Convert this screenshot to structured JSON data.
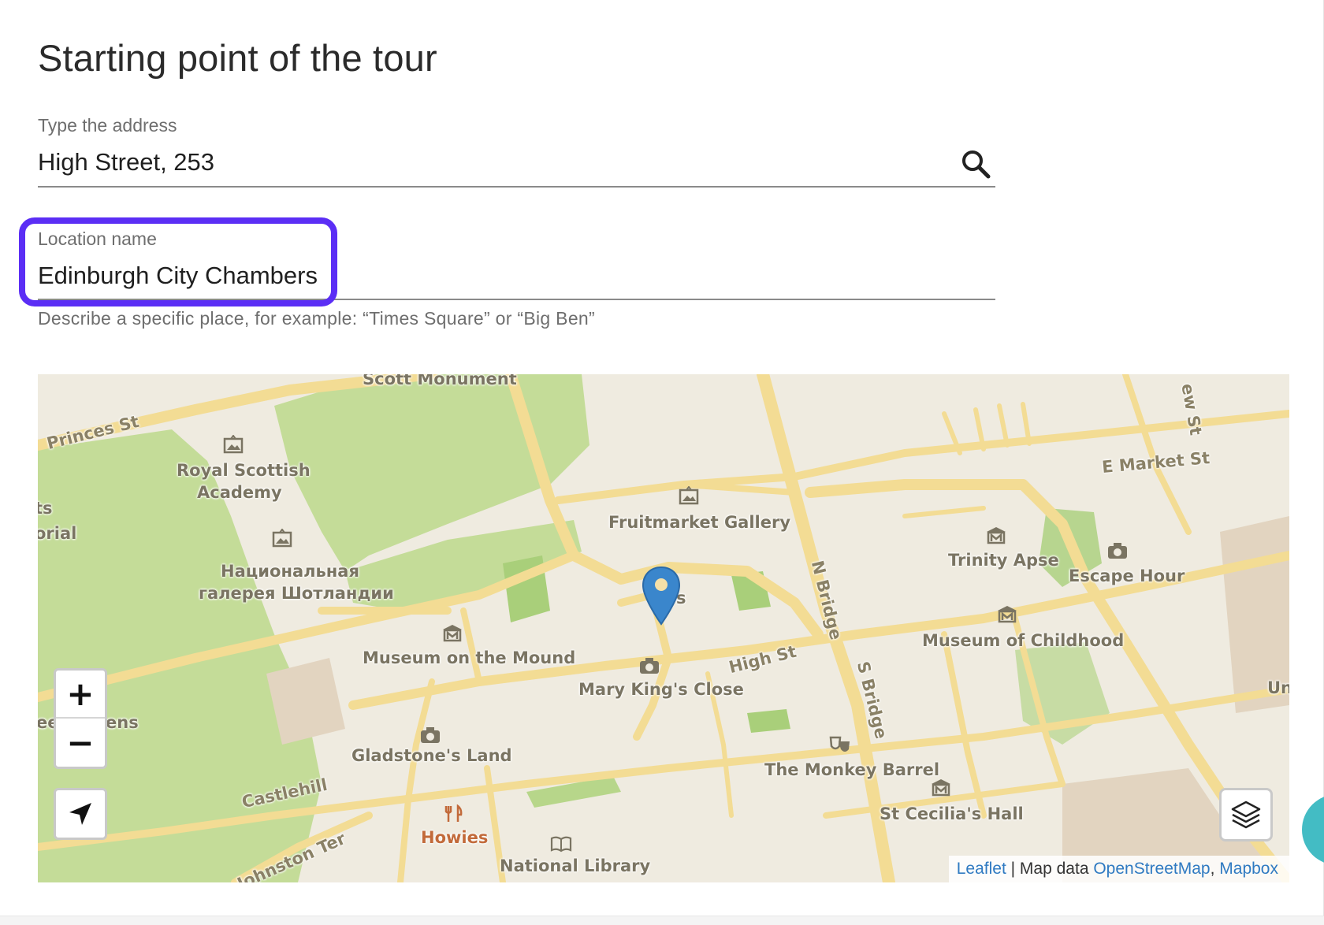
{
  "page": {
    "title": "Starting point of the tour"
  },
  "address": {
    "label": "Type the address",
    "value": "High Street, 253",
    "search_icon": "search-icon"
  },
  "location": {
    "label": "Location name",
    "value": "Edinburgh City Chambers",
    "helper": "Describe a specific place, for example: “Times Square” or “Big Ben”"
  },
  "map": {
    "labels": {
      "scott_monument": "Scott Monument",
      "princes_st": "Princes St",
      "royal_scottish": "Royal Scottish",
      "academy": "Academy",
      "natsionalnaya": "Национальная",
      "galereya": "галерея Шотландии",
      "fruitmarket": "Fruitmarket Gallery",
      "museum_mound": "Museum on the Mound",
      "mary_kings": "Mary King's Close",
      "high_st": "High St",
      "n_bridge": "N Bridge",
      "s_bridge": "S Bridge",
      "e_market_st": "E Market St",
      "trinity_apse": "Trinity Apse",
      "escape_hour": "Escape Hour",
      "museum_childhood": "Museum of Childhood",
      "gladstones": "Gladstone's Land",
      "monkey_barrel": "The Monkey Barrel",
      "st_cecilias": "St Cecilia's Hall",
      "castlehill": "Castlehill",
      "howies": "Howies",
      "johnston_ter": "Johnston Ter",
      "national_library": "National Library",
      "ts": "ts",
      "orial": "orial",
      "eet": "eet",
      "ens": "ens",
      "s_partial": "s",
      "un": "Un",
      "ew_st": "ew St"
    },
    "controls": {
      "zoom_in": "+",
      "zoom_out": "−"
    },
    "attribution": {
      "leaflet": "Leaflet",
      "separator": " | Map data ",
      "osm": "OpenStreetMap",
      "comma": ", ",
      "mapbox": "Mapbox"
    },
    "colors": {
      "park": "#c4dc98",
      "road": "#f3dc94",
      "base": "#efebe0",
      "marker": "#3a86cc"
    }
  }
}
